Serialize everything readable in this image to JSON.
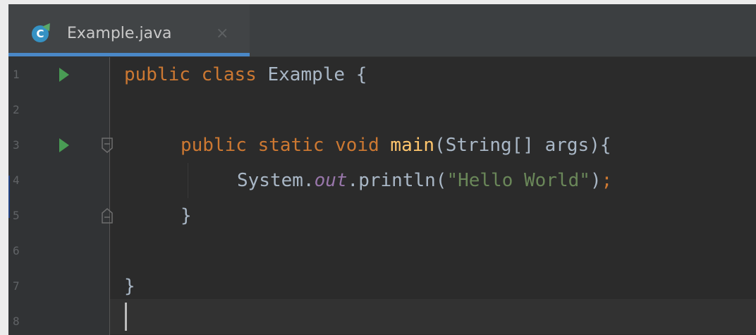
{
  "tab": {
    "icon_letter": "C",
    "file_name": "Example.java",
    "close_glyph": "×"
  },
  "editor": {
    "line_numbers": [
      "1",
      "2",
      "3",
      "4",
      "5",
      "6",
      "7",
      "8"
    ],
    "code": {
      "l1_kw": "public class",
      "l1_rest": " Example {",
      "l3_kw": "public static void",
      "l3_method": "main",
      "l3_rest": "(String[] args){",
      "l4_obj": "System.",
      "l4_field": "out",
      "l4_call": ".println(",
      "l4_str": "\"Hello World\"",
      "l4_end": ")",
      "l4_semi": ";",
      "l5_brace": "}",
      "l7_brace": "}"
    }
  },
  "colors": {
    "editor_background": "#2b2b2b",
    "gutter_background": "#313335",
    "keyword": "#cc7832",
    "method": "#ffc66d",
    "field": "#9876aa",
    "string": "#6a8759",
    "run_icon": "#499c54",
    "tab_underline": "#4a88c7"
  },
  "icons": [
    "java-class-icon",
    "close-icon",
    "run-icon",
    "fold-icon"
  ]
}
